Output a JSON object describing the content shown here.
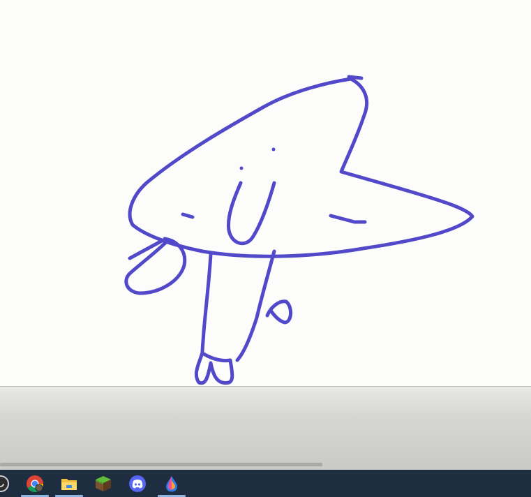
{
  "canvas": {
    "background": "#fcfcfa",
    "stroke_color": "#5149c9"
  },
  "taskbar": {
    "background": "#1f2d40",
    "apps": [
      {
        "name": "partial-app-icon",
        "running": false
      },
      {
        "name": "chrome-icon",
        "running": true
      },
      {
        "name": "file-explorer-icon",
        "running": true
      },
      {
        "name": "minecraft-icon",
        "running": false
      },
      {
        "name": "discord-icon",
        "running": false
      },
      {
        "name": "drawing-app-icon",
        "running": true
      }
    ]
  }
}
